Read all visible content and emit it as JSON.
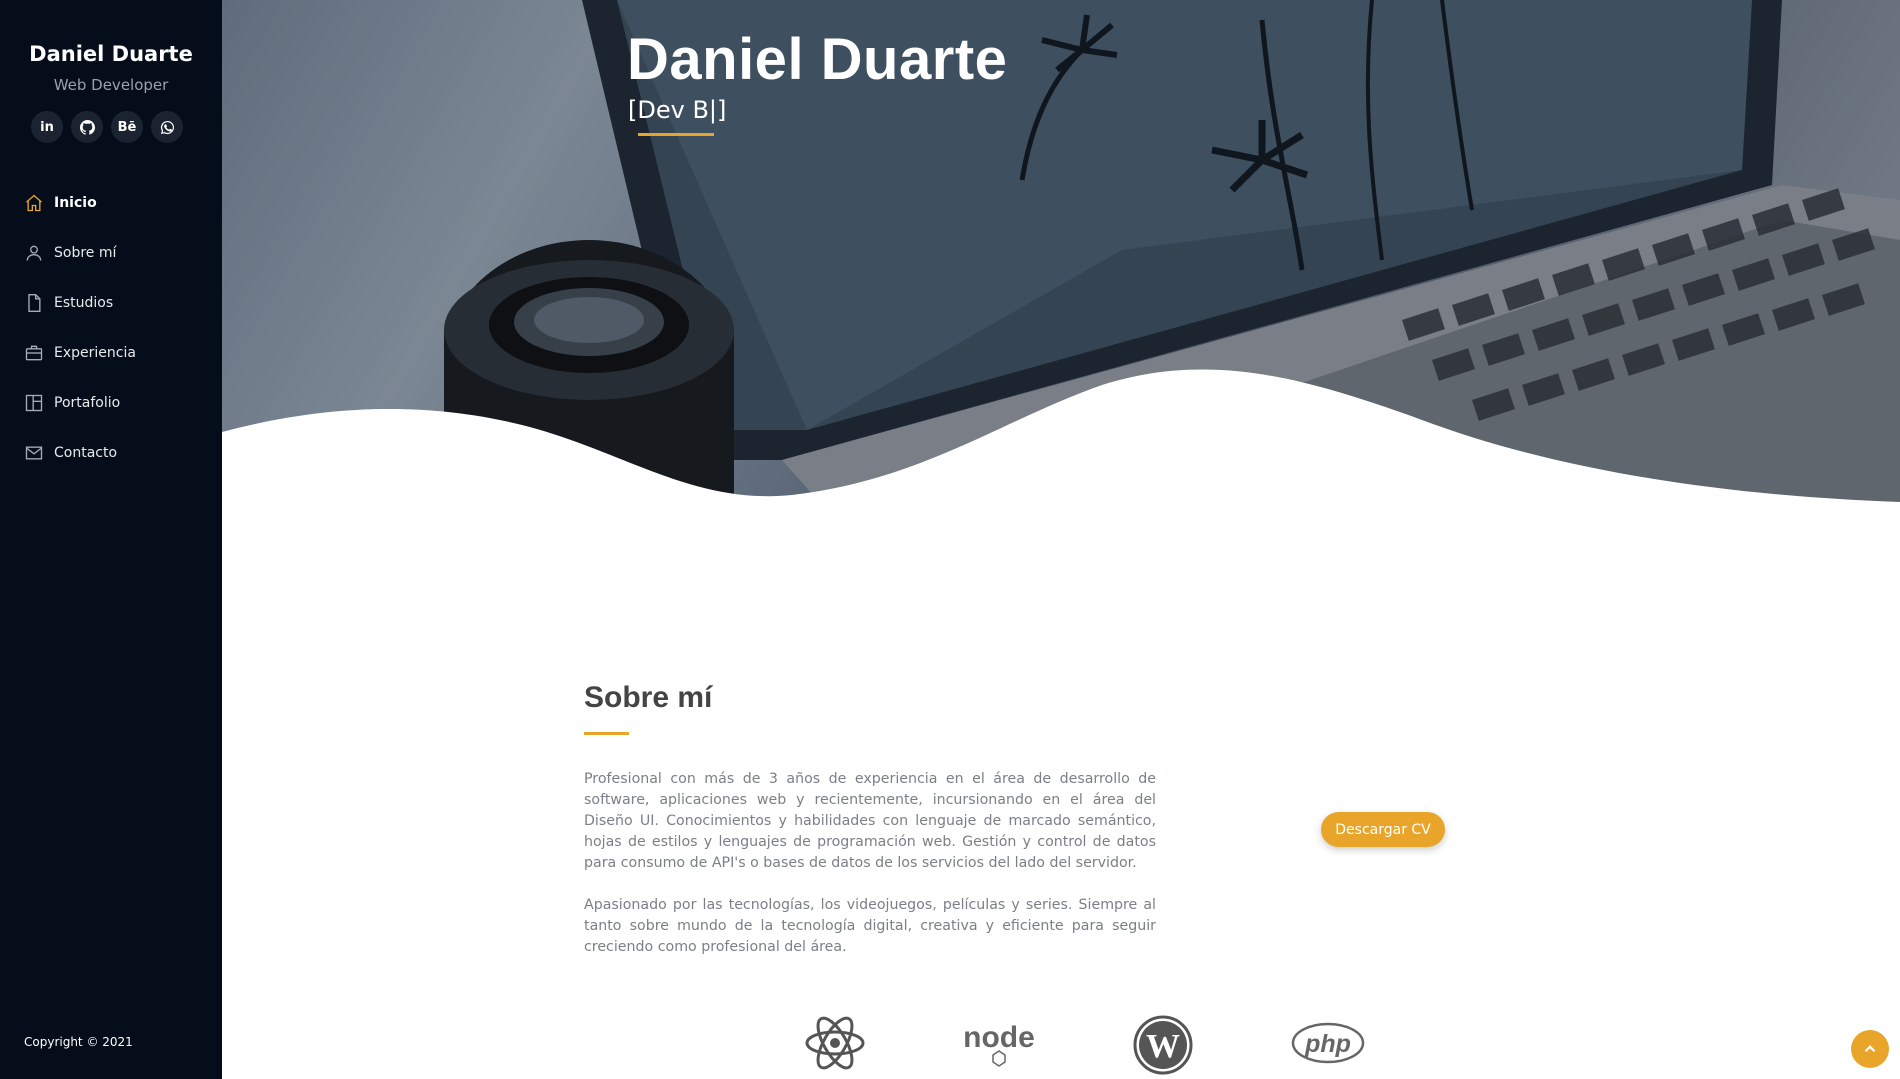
{
  "sidebar": {
    "name": "Daniel Duarte",
    "role": "Web Developer",
    "socials": [
      {
        "icon": "linkedin-icon",
        "text": "in"
      },
      {
        "icon": "github-icon",
        "text": ""
      },
      {
        "icon": "behance-icon",
        "text": "Bē"
      },
      {
        "icon": "whatsapp-icon",
        "text": ""
      }
    ],
    "nav": [
      {
        "label": "Inicio",
        "icon": "home-icon",
        "active": true
      },
      {
        "label": "Sobre mí",
        "icon": "user-icon",
        "active": false
      },
      {
        "label": "Estudios",
        "icon": "document-icon",
        "active": false
      },
      {
        "label": "Experiencia",
        "icon": "briefcase-icon",
        "active": false
      },
      {
        "label": "Portafolio",
        "icon": "layout-icon",
        "active": false
      },
      {
        "label": "Contacto",
        "icon": "envelope-icon",
        "active": false
      }
    ],
    "copyright": "Copyright © 2021"
  },
  "hero": {
    "title": "Daniel Duarte",
    "typed": "[Dev B|]"
  },
  "about": {
    "title": "Sobre mí",
    "paragraph1": "Profesional con más de 3 años de experiencia en el área de desarrollo de software, aplicaciones web y recientemente, incursionando en el área del Diseño UI. Conocimientos y habilidades con lenguaje de marcado semántico, hojas de estilos y lenguajes de programación web. Gestión y control de datos para consumo de API's o bases de datos de los servicios del lado del servidor.",
    "paragraph2": "Apasionado por las tecnologías, los videojuegos, películas y series. Siempre al tanto sobre mundo de la tecnología digital, creativa y eficiente para seguir creciendo como profesional del área.",
    "cv_button": "Descargar CV"
  },
  "technologies": [
    {
      "icon": "react-icon"
    },
    {
      "icon": "nodejs-icon",
      "text": "node"
    },
    {
      "icon": "wordpress-icon"
    },
    {
      "icon": "php-icon",
      "text": "php"
    }
  ],
  "colors": {
    "accent": "#e8a52a",
    "sidebar_bg": "#050d1a"
  }
}
